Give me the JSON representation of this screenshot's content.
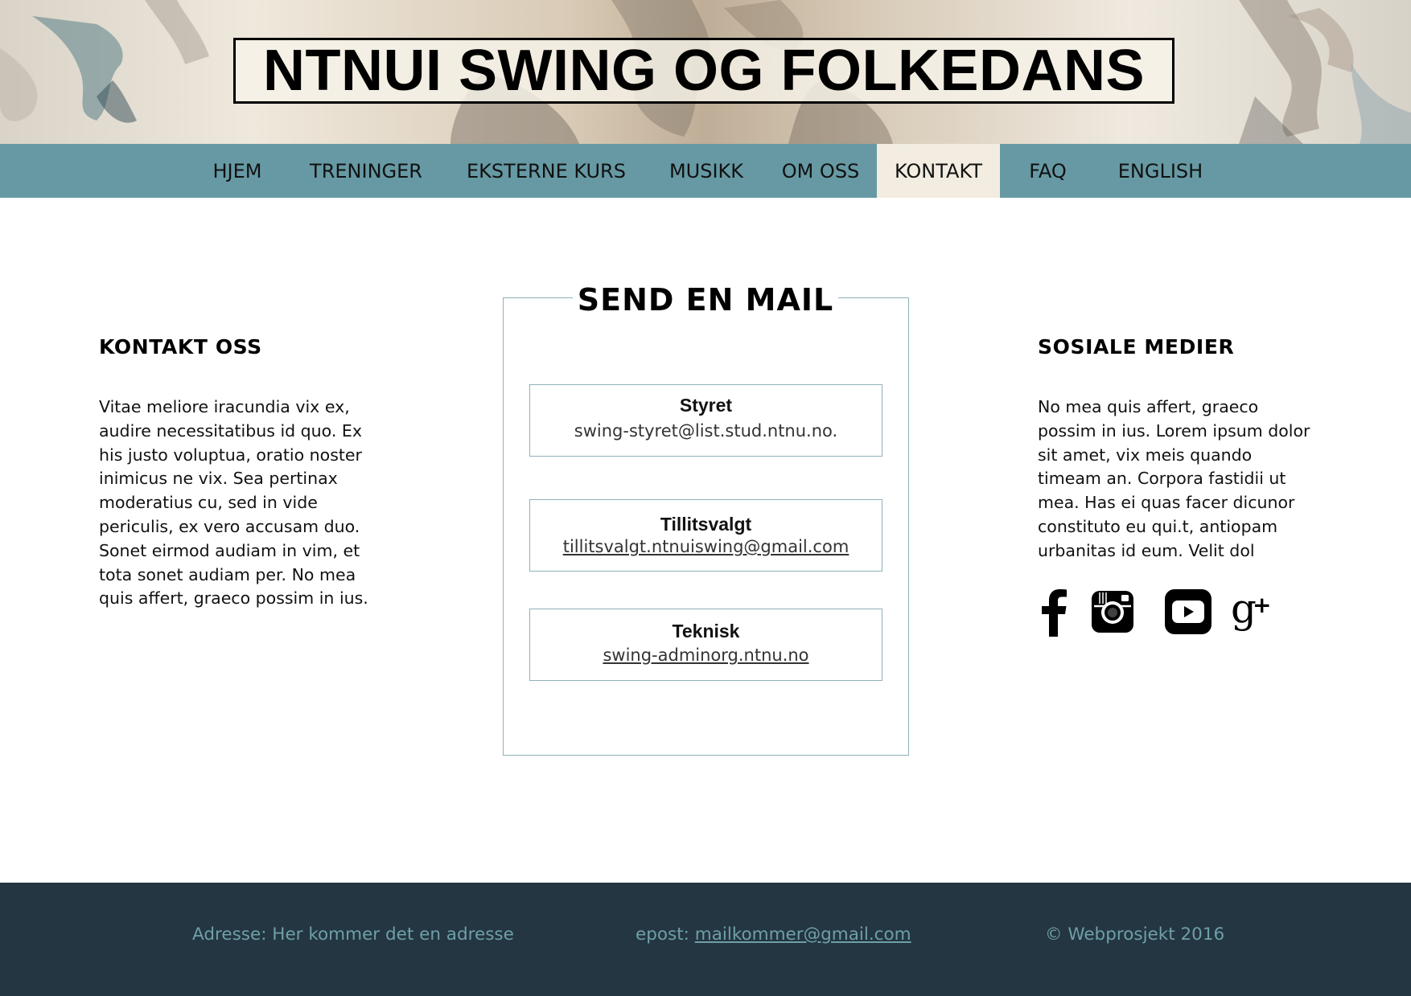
{
  "header": {
    "title": "NTNUI SWING OG FOLKEDANS"
  },
  "nav": {
    "items": [
      {
        "label": "HJEM"
      },
      {
        "label": "TRENINGER"
      },
      {
        "label": "EKSTERNE KURS"
      },
      {
        "label": "MUSIKK"
      },
      {
        "label": "OM OSS"
      },
      {
        "label": "KONTAKT",
        "active": true
      },
      {
        "label": "FAQ"
      },
      {
        "label": "ENGLISH"
      }
    ],
    "active_color": "#f2ede0",
    "bar_color": "#6699a3"
  },
  "contact": {
    "heading": "KONTAKT OSS",
    "text": "Vitae meliore iracundia vix ex, audire necessitatibus id quo. Ex his justo voluptua, oratio noster inimicus ne vix. Sea pertinax moderatius cu, sed in vide periculis, ex vero accusam duo. Sonet eirmod audiam in vim, et tota sonet audiam per. No mea quis affert, graeco possim in ius."
  },
  "mail": {
    "heading": "SEND EN MAIL",
    "contacts": [
      {
        "name": "Styret",
        "email": "swing-styret@list.stud.ntnu.no."
      },
      {
        "name": "Tillitsvalgt",
        "email": "tillitsvalgt.ntnuiswing@gmail.com"
      },
      {
        "name": "Teknisk",
        "email": "swing-adminorg.ntnu.no"
      }
    ]
  },
  "social": {
    "heading": "SOSIALE MEDIER",
    "text": "No mea quis affert, graeco possim in ius. Lorem ipsum dolor sit amet, vix meis quando timeam an. Corpora fastidii ut mea. Has ei quas facer dicunor constituto eu qui.t, antiopam urbanitas id eum. Velit dol",
    "icons": [
      "facebook-icon",
      "instagram-icon",
      "youtube-icon",
      "google-plus-icon"
    ]
  },
  "footer": {
    "address": "Adresse: Her kommer det en adresse",
    "email_label": "epost: ",
    "email": "mailkommer@gmail.com",
    "copyright": "© Webprosjekt 2016",
    "bg_color": "#233641",
    "text_color": "#6f9fa8"
  }
}
